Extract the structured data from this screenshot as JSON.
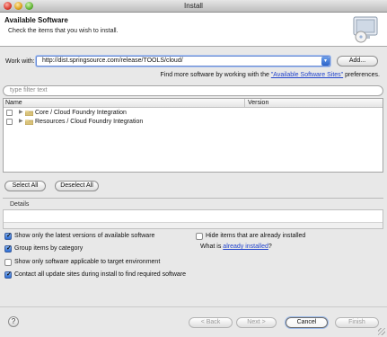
{
  "window": {
    "title": "Install"
  },
  "header": {
    "title": "Available Software",
    "subtitle": "Check the items that you wish to install.",
    "icon": "install-wizard-icon"
  },
  "work_with": {
    "label": "Work with:",
    "value": "http://dist.springsource.com/release/TOOLS/cloud/",
    "add_label": "Add..."
  },
  "find_more": {
    "prefix": "Find more software by working with the ",
    "link": "\"Available Software Sites\"",
    "suffix": " preferences."
  },
  "filter": {
    "placeholder": "type filter text"
  },
  "tree": {
    "columns": [
      "Name",
      "Version"
    ],
    "rows": [
      {
        "expand": "▶",
        "label": "Core / Cloud Foundry Integration",
        "checked": false
      },
      {
        "expand": "▶",
        "label": "Resources / Cloud Foundry Integration",
        "checked": false
      }
    ]
  },
  "selection": {
    "select_all": "Select All",
    "deselect_all": "Deselect All"
  },
  "details": {
    "label": "Details"
  },
  "options": {
    "latest_versions": {
      "label": "Show only the latest versions of available software",
      "checked": true
    },
    "group_by_category": {
      "label": "Group items by category",
      "checked": true
    },
    "applicable_only": {
      "label": "Show only software applicable to target environment",
      "checked": false
    },
    "contact_sites": {
      "label": "Contact all update sites during install to find required software",
      "checked": true
    },
    "hide_installed": {
      "label": "Hide items that are already installed",
      "checked": false
    }
  },
  "what_is": {
    "prefix": "What is ",
    "link": "already installed",
    "suffix": "?"
  },
  "footer": {
    "help": "?",
    "back": "< Back",
    "next": "Next >",
    "cancel": "Cancel",
    "finish": "Finish"
  },
  "colors": {
    "accent": "#2a6bd4",
    "link": "#2244cc"
  }
}
